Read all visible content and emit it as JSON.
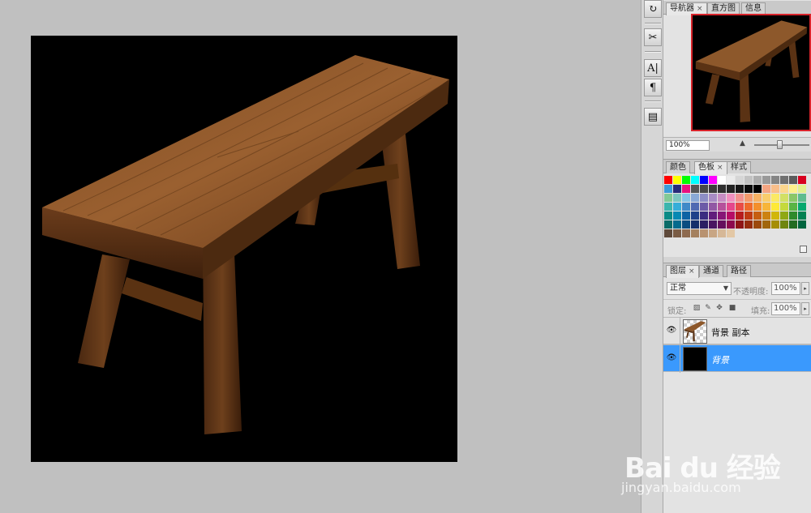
{
  "toolstrip": {
    "items": [
      {
        "name": "history-icon",
        "glyph": "↻"
      },
      {
        "name": "tools-preset-icon",
        "glyph": "✂"
      },
      {
        "name": "character-icon",
        "glyph": "A|"
      },
      {
        "name": "paragraph-icon",
        "glyph": "¶"
      },
      {
        "name": "notes-icon",
        "glyph": "▤"
      }
    ]
  },
  "navigator": {
    "tabs": [
      {
        "label": "导航器",
        "close": "×",
        "active": true
      },
      {
        "label": "直方图",
        "close": "",
        "active": false
      },
      {
        "label": "信息",
        "close": "",
        "active": false
      }
    ],
    "zoom": "100%"
  },
  "swatches": {
    "tabs": [
      {
        "label": "颜色",
        "close": "",
        "active": false
      },
      {
        "label": "色板",
        "close": "×",
        "active": true
      },
      {
        "label": "样式",
        "close": "",
        "active": false
      }
    ],
    "rows": [
      [
        "#ff0000",
        "#ffff00",
        "#00ff00",
        "#00ffff",
        "#0000ff",
        "#ff00ff",
        "#ffffff",
        "#ebebeb",
        "#d6d6d6",
        "#c2c2c2",
        "#adadad",
        "#999999",
        "#858585",
        "#707070",
        "#5c5c5c",
        "#d8001f"
      ],
      [
        "#3d9bd8",
        "#292b7a",
        "#e8117f",
        "#555555",
        "#484848",
        "#3c3c3c",
        "#2f2f2f",
        "#232323",
        "#161616",
        "#0a0a0a",
        "#000000",
        "#f4a582",
        "#f9be8a",
        "#fcd68d",
        "#fef08c",
        "#e3ef8e"
      ],
      [
        "#82c996",
        "#7dc7c0",
        "#86c5e6",
        "#8aa9d6",
        "#8d8ec5",
        "#a88cc4",
        "#c78dc3",
        "#f090bf",
        "#f2928f",
        "#f39a6c",
        "#f5b163",
        "#f9cd6c",
        "#fbe964",
        "#d2e065",
        "#8bc768",
        "#5fbc8e"
      ],
      [
        "#3cb5ad",
        "#35aed9",
        "#3f8ac8",
        "#4f6ab2",
        "#6c5ba7",
        "#9158a4",
        "#b6519b",
        "#e5478b",
        "#e94c46",
        "#ee6a2b",
        "#f38f2b",
        "#f7b53a",
        "#fee938",
        "#c5d93d",
        "#59b445",
        "#06a86e"
      ],
      [
        "#0a8a85",
        "#0788b3",
        "#0d63a4",
        "#1f418a",
        "#3b2c80",
        "#611d7c",
        "#871677",
        "#b60c66",
        "#b71d1d",
        "#bf3b12",
        "#c65e10",
        "#cc8211",
        "#d1b60a",
        "#8fa814",
        "#2e8a2c",
        "#038152"
      ],
      [
        "#0b6b68",
        "#046a8d",
        "#0b4c80",
        "#152f6b",
        "#2b1f63",
        "#491561",
        "#650f5d",
        "#8d0a4e",
        "#8f1616",
        "#962d0e",
        "#9c490d",
        "#a1660d",
        "#a68e06",
        "#6f850f",
        "#236c22",
        "#02653f"
      ],
      [
        "#5f4a3b",
        "#7a5c45",
        "#8e6a4f",
        "#a4805e",
        "#b89270",
        "#c8a684",
        "#d6b897",
        "#e3c8a6"
      ]
    ]
  },
  "layers": {
    "tabs": [
      {
        "label": "图层",
        "close": "×",
        "active": true
      },
      {
        "label": "通道",
        "close": "",
        "active": false
      },
      {
        "label": "路径",
        "close": "",
        "active": false
      }
    ],
    "blend_mode": "正常",
    "opacity_label": "不透明度:",
    "opacity": "100%",
    "lock_label": "锁定:",
    "fill_label": "填充:",
    "fill": "100%",
    "items": [
      {
        "name": "背景 副本",
        "visible": true,
        "selected": false
      },
      {
        "name": "背景",
        "visible": true,
        "selected": true
      }
    ]
  },
  "watermark": {
    "logo": "Bai du 经验",
    "url": "jingyan.baidu.com"
  }
}
